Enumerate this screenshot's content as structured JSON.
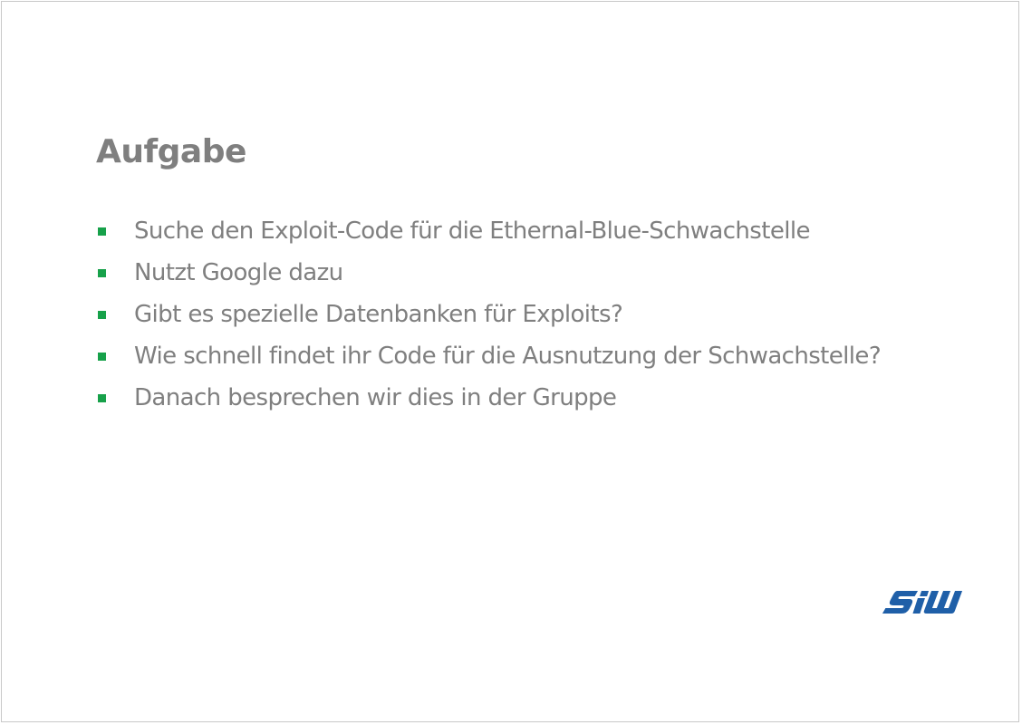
{
  "slide": {
    "title": "Aufgabe",
    "bullets": [
      "Suche den Exploit-Code für die Ethernal-Blue-Schwachstelle",
      "Nutzt Google dazu",
      "Gibt es spezielle Datenbanken für Exploits?",
      "Wie schnell findet ihr Code für die Ausnutzung der Schwachstelle?",
      "Danach besprechen wir dies in der Gruppe"
    ],
    "logo": {
      "text": "SIW",
      "color": "#1f5fa8",
      "accent": "#ffffff"
    },
    "colors": {
      "title": "#7f7f7f",
      "text": "#7f7f7f",
      "bullet": "#17a14a",
      "border": "#c8c8c8"
    }
  }
}
